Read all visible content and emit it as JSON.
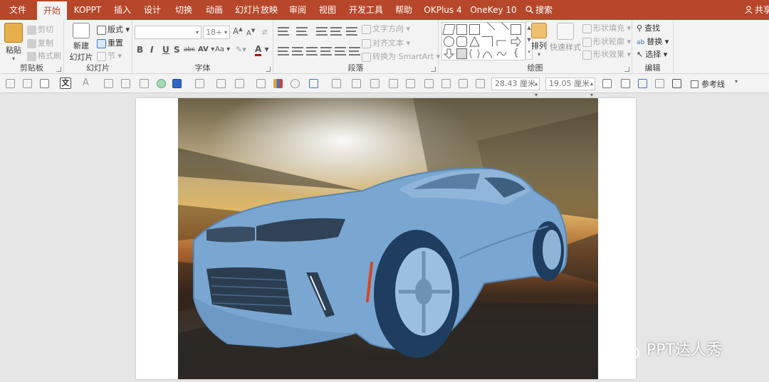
{
  "tabs": [
    {
      "label": "文件",
      "active": false
    },
    {
      "label": "开始",
      "active": true
    },
    {
      "label": "KOPPT",
      "active": false
    },
    {
      "label": "插入",
      "active": false
    },
    {
      "label": "设计",
      "active": false
    },
    {
      "label": "切换",
      "active": false
    },
    {
      "label": "动画",
      "active": false
    },
    {
      "label": "幻灯片放映",
      "active": false
    },
    {
      "label": "审阅",
      "active": false
    },
    {
      "label": "视图",
      "active": false
    },
    {
      "label": "开发工具",
      "active": false
    },
    {
      "label": "帮助",
      "active": false
    },
    {
      "label": "OKPlus 4",
      "active": false
    },
    {
      "label": "OneKey 10",
      "active": false
    }
  ],
  "tell_me": "搜索",
  "share": "共享",
  "ribbon": {
    "clipboard": {
      "label": "剪贴板",
      "paste": "粘贴",
      "cut": "剪切",
      "copy": "复制",
      "format_painter": "格式刷"
    },
    "slides": {
      "label": "幻灯片",
      "new_slide_l1": "新建",
      "new_slide_l2": "幻灯片",
      "layout": "版式",
      "reset": "重置",
      "section": "节"
    },
    "font": {
      "label": "字体",
      "font_name": "",
      "font_size": "18+",
      "bold": "B",
      "italic": "I",
      "underline": "U",
      "shadow": "S",
      "strike": "abc",
      "spacing": "AV",
      "case": "Aa",
      "color": "A",
      "grow": "A",
      "shrink": "A"
    },
    "paragraph": {
      "label": "段落",
      "text_direction": "文字方向",
      "align_text": "对齐文本",
      "smartart": "转换为 SmartArt"
    },
    "drawing": {
      "label": "绘图",
      "arrange": "排列",
      "quick_styles": "快速样式",
      "shape_fill": "形状填充",
      "shape_outline": "形状轮廓",
      "shape_effects": "形状效果"
    },
    "editing": {
      "label": "编辑",
      "find": "查找",
      "replace": "替换",
      "select": "选择"
    }
  },
  "format_toolbar": {
    "width": "28.43 厘米",
    "height": "19.05 厘米",
    "guides": "参考线",
    "text_icon": "文"
  },
  "watermark": "PPT达人秀",
  "colors": {
    "tab_bar": "#b7472a",
    "ribbon_bg": "#f3f3f3",
    "workspace": "#e6e6e6",
    "car_tint": "#6e9cc8"
  }
}
